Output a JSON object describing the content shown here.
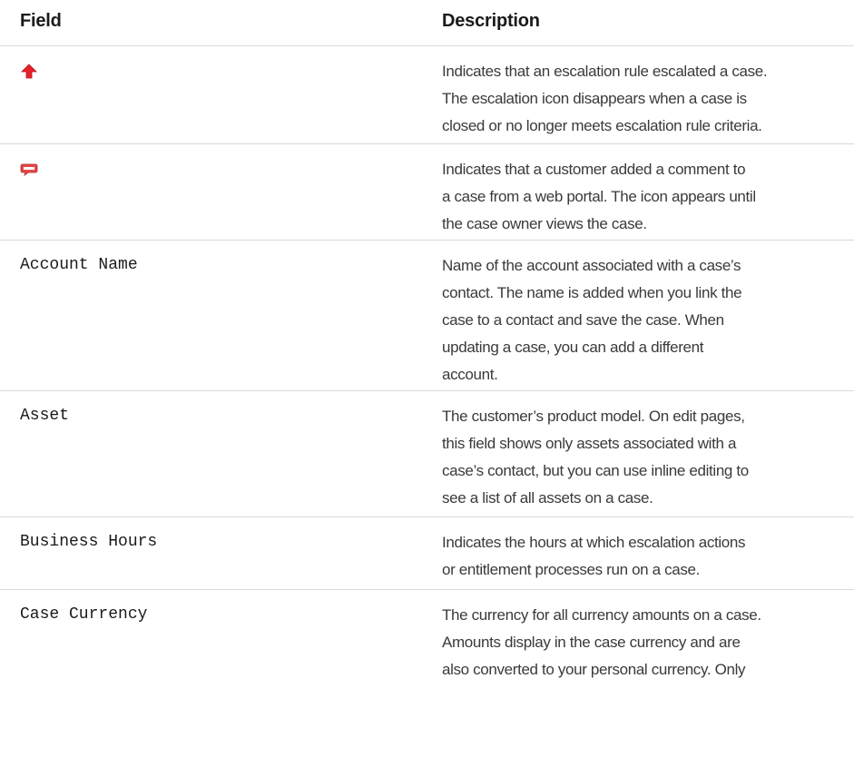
{
  "header": {
    "field": "Field",
    "description": "Description"
  },
  "rows": [
    {
      "field": "",
      "icon": "escalation-arrow-icon",
      "desc": [
        "Indicates that an escalation rule escalated a case.",
        "The escalation icon disappears when a case is",
        "closed or no longer meets escalation rule criteria."
      ]
    },
    {
      "field": "",
      "icon": "comment-bubble-icon",
      "desc": [
        "Indicates that a customer added a comment to",
        "a case from a web portal. The icon appears until",
        "the case owner views the case."
      ]
    },
    {
      "field": "Account Name",
      "desc": [
        "Name of the account associated with a case’s",
        "contact. The name is added when you link the",
        "case to a contact and save the case. When",
        "updating a case, you can add a different",
        "account."
      ]
    },
    {
      "field": "Asset",
      "desc": [
        "The customer’s product model. On edit pages,",
        "this field shows only assets associated with a",
        "case’s contact, but you can use inline editing to",
        "see a list of all assets on a case."
      ]
    },
    {
      "field": "Business Hours",
      "desc": [
        "Indicates the hours at which escalation actions",
        "or entitlement processes run on a case."
      ]
    },
    {
      "field": "Case Currency",
      "desc": [
        "The currency for all currency amounts on a case.",
        "Amounts display in the case currency and are",
        "also converted to your personal currency. Only"
      ]
    }
  ],
  "colors": {
    "escalation_icon": "#e8202a",
    "comment_icon": "#e84848"
  }
}
